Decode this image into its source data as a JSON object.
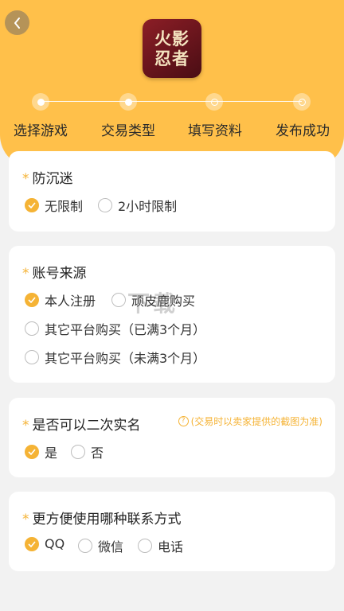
{
  "logo": {
    "text": "火影忍者"
  },
  "steps": [
    {
      "label": "选择游戏",
      "state": "done"
    },
    {
      "label": "交易类型",
      "state": "done"
    },
    {
      "label": "填写资料",
      "state": "pending"
    },
    {
      "label": "发布成功",
      "state": "pending"
    }
  ],
  "sections": {
    "addiction": {
      "required_mark": "*",
      "title": "防沉迷",
      "options": [
        "无限制",
        "2小时限制"
      ],
      "selected": "无限制"
    },
    "account_source": {
      "required_mark": "*",
      "title": "账号来源",
      "options": [
        "本人注册",
        "顽皮鹿购买",
        "其它平台购买（已满3个月）",
        "其它平台购买（未满3个月）"
      ],
      "selected": "本人注册"
    },
    "real_name": {
      "required_mark": "*",
      "title": "是否可以二次实名",
      "hint": "(交易时以卖家提供的截图为准)",
      "hint_icon": "?",
      "options": [
        "是",
        "否"
      ],
      "selected": "是"
    },
    "contact": {
      "required_mark": "*",
      "title": "更方便使用哪种联系方式",
      "options": [
        "QQ",
        "微信",
        "电话"
      ],
      "selected": "QQ"
    }
  },
  "watermark": "下载",
  "colors": {
    "accent": "#f5b335",
    "header": "#ffc04a",
    "logo_bg": "#6b1520"
  }
}
